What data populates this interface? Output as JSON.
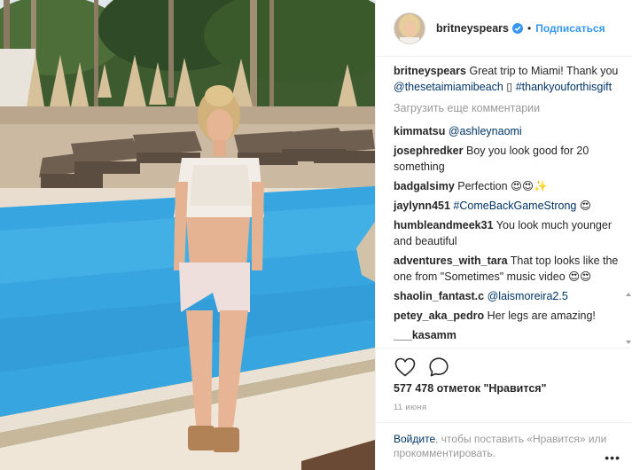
{
  "header": {
    "username": "britneyspears",
    "verified": true,
    "separator": "•",
    "follow_label": "Подписаться"
  },
  "caption": {
    "username": "britneyspears",
    "text_1": "Great trip to Miami! Thank you ",
    "mention": "@thesetaimiamibeach",
    "emoji": " ▯ ",
    "hashtag": "#thankyouforthisgift"
  },
  "load_more_label": "Загрузить еще комментарии",
  "comments": [
    {
      "user": "kimmatsu",
      "text": "",
      "link": "@ashleynaomi",
      "after": ""
    },
    {
      "user": "josephredker",
      "text": "Boy you look good for 20 something",
      "link": "",
      "after": ""
    },
    {
      "user": "badgalsimy",
      "text": "Perfection 😍😍✨",
      "link": "",
      "after": ""
    },
    {
      "user": "jaylynn451",
      "text": "",
      "link": "#ComeBackGameStrong",
      "after": " 😍"
    },
    {
      "user": "humbleandmeek31",
      "text": "You look much younger and beautiful",
      "link": "",
      "after": ""
    },
    {
      "user": "adventures_with_tara",
      "text": "That top looks like the one from \"Sometimes\" music video 😍😍",
      "link": "",
      "after": ""
    },
    {
      "user": "shaolin_fantast.c",
      "text": "",
      "link": "@laismoreira2.5",
      "after": ""
    },
    {
      "user": "petey_aka_pedro",
      "text": "Her legs are amazing!",
      "link": "",
      "after": ""
    },
    {
      "user": "___kasamm",
      "text": "",
      "link": "",
      "after": ""
    }
  ],
  "likes_label": "577 478 отметок \"Нравится\"",
  "date_label": "11 июня",
  "login_prompt": {
    "link": "Войдите",
    "text": ", чтобы поставить «Нравится» или прокомментировать."
  },
  "more_label": "•••",
  "icons": {
    "like": "heart-outline-icon",
    "comment": "speech-bubble-icon",
    "verified": "verified-badge-icon",
    "more": "more-dots-icon"
  },
  "colors": {
    "link_blue": "#3897f0",
    "text": "#262626",
    "muted": "#999999",
    "pool": "#37a6e0"
  }
}
